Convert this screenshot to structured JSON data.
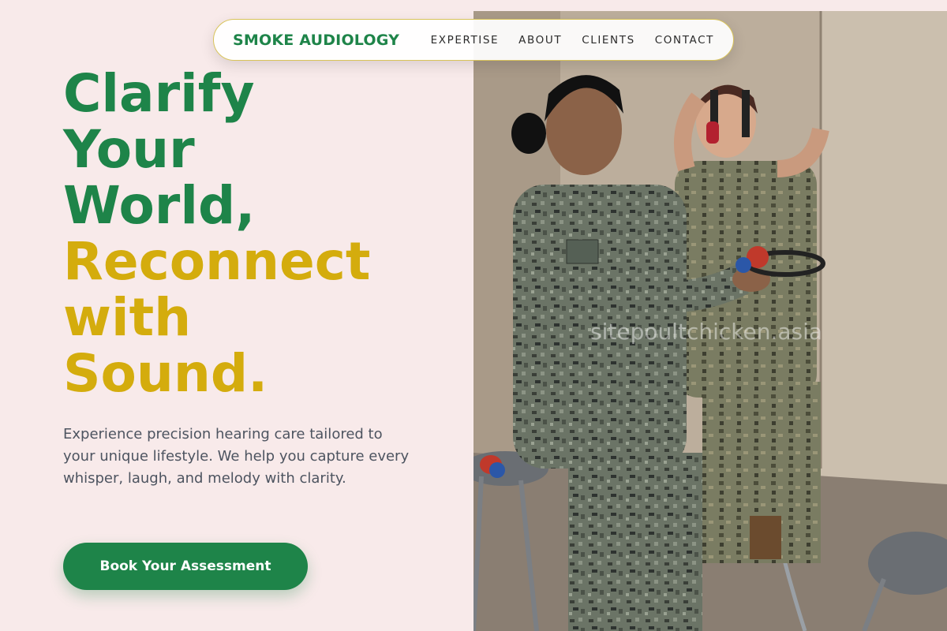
{
  "nav": {
    "brand": "SMOKE AUDIOLOGY",
    "links": [
      "EXPERTISE",
      "ABOUT",
      "CLIENTS",
      "CONTACT"
    ]
  },
  "hero": {
    "line1": "Clarify",
    "line2": "Your",
    "line3": "World,",
    "line4": "Reconnect",
    "line5": "with",
    "line6": "Sound.",
    "subtext": "Experience precision hearing care tailored to your unique lifestyle. We help you capture every whisper, laugh, and melody with clarity.",
    "cta": "Book Your Assessment"
  },
  "photo": {
    "watermark": "sitepoultchicken.asia",
    "description_icon": "photo-hearing-test"
  },
  "colors": {
    "background": "#f8eaea",
    "green": "#1e8449",
    "gold": "#d4ac0d",
    "text": "#4d5460"
  }
}
